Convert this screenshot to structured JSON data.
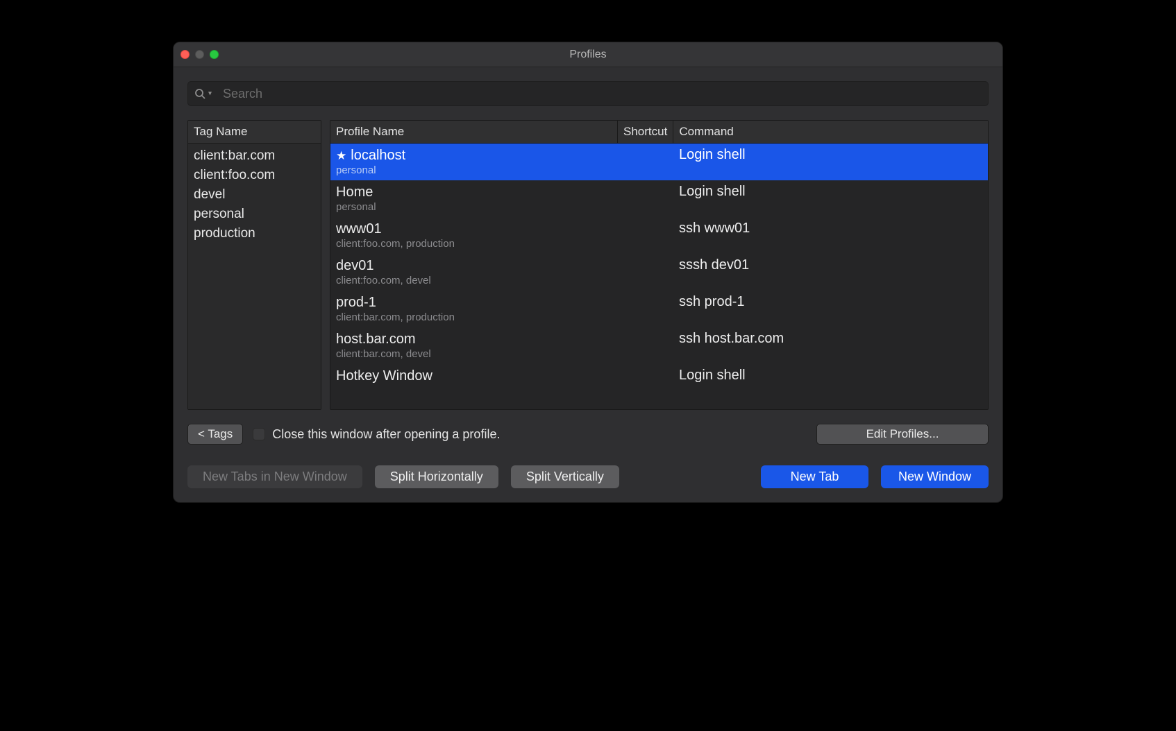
{
  "window": {
    "title": "Profiles"
  },
  "search": {
    "placeholder": "Search",
    "value": ""
  },
  "tags_panel": {
    "header": "Tag Name",
    "items": [
      "client:bar.com",
      "client:foo.com",
      "devel",
      "personal",
      "production"
    ]
  },
  "profiles_panel": {
    "columns": {
      "name": "Profile Name",
      "shortcut": "Shortcut",
      "command": "Command"
    },
    "rows": [
      {
        "name": "localhost",
        "tags": "personal",
        "shortcut": "",
        "command": "Login shell",
        "starred": true,
        "selected": true
      },
      {
        "name": "Home",
        "tags": "personal",
        "shortcut": "",
        "command": "Login shell",
        "starred": false,
        "selected": false
      },
      {
        "name": "www01",
        "tags": "client:foo.com, production",
        "shortcut": "",
        "command": "ssh www01",
        "starred": false,
        "selected": false
      },
      {
        "name": "dev01",
        "tags": "client:foo.com, devel",
        "shortcut": "",
        "command": "sssh dev01",
        "starred": false,
        "selected": false
      },
      {
        "name": "prod-1",
        "tags": "client:bar.com, production",
        "shortcut": "",
        "command": "ssh prod-1",
        "starred": false,
        "selected": false
      },
      {
        "name": "host.bar.com",
        "tags": "client:bar.com, devel",
        "shortcut": "",
        "command": "ssh host.bar.com",
        "starred": false,
        "selected": false
      },
      {
        "name": "Hotkey Window",
        "tags": "",
        "shortcut": "",
        "command": "Login shell",
        "starred": false,
        "selected": false
      }
    ]
  },
  "controls": {
    "tags_button": "< Tags",
    "close_checkbox_label": "Close this window after opening a profile.",
    "close_checked": false,
    "edit_button": "Edit Profiles..."
  },
  "buttons": {
    "new_tabs_new_window": "New Tabs in New Window",
    "split_horizontally": "Split Horizontally",
    "split_vertically": "Split Vertically",
    "new_tab": "New Tab",
    "new_window": "New Window"
  }
}
